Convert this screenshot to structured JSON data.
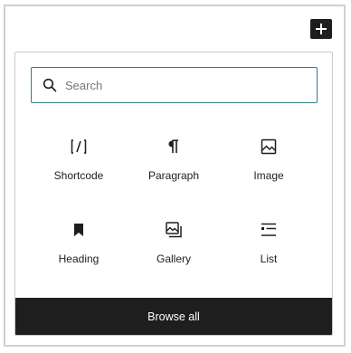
{
  "search": {
    "placeholder": "Search",
    "value": ""
  },
  "blocks": [
    {
      "label": "Shortcode",
      "icon": "shortcode-icon"
    },
    {
      "label": "Paragraph",
      "icon": "paragraph-icon"
    },
    {
      "label": "Image",
      "icon": "image-icon"
    },
    {
      "label": "Heading",
      "icon": "bookmark-icon"
    },
    {
      "label": "Gallery",
      "icon": "gallery-icon"
    },
    {
      "label": "List",
      "icon": "list-icon"
    }
  ],
  "browse_all_label": "Browse all",
  "colors": {
    "accent": "#2f7a8f",
    "dark": "#1e1e1e",
    "border": "#cccccc"
  }
}
